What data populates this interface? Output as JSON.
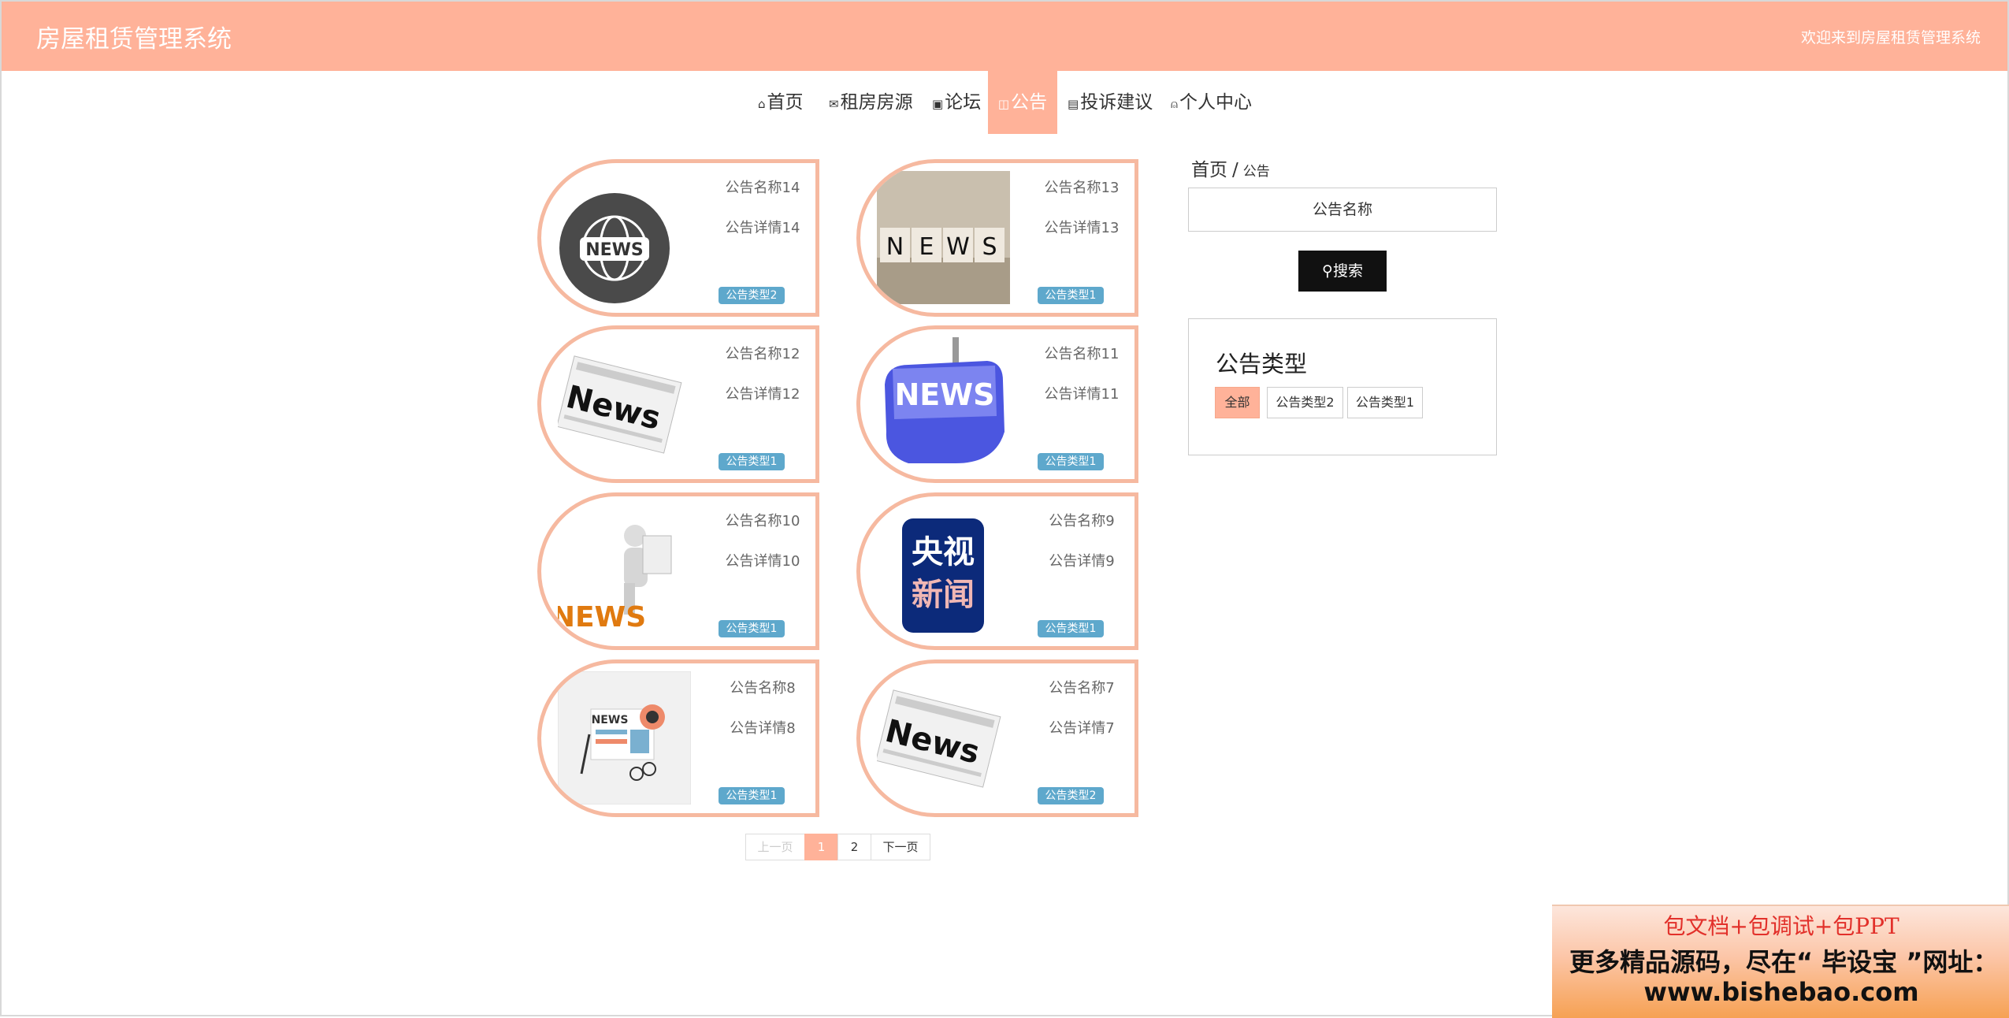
{
  "header": {
    "title": "房屋租赁管理系统",
    "welcome": "欢迎来到房屋租赁管理系统"
  },
  "nav": {
    "items": [
      {
        "icon": "home-icon",
        "glyph": "⌂",
        "label": "首页"
      },
      {
        "icon": "mail-icon",
        "glyph": "✉",
        "label": "租房房源"
      },
      {
        "icon": "gift-icon",
        "glyph": "▣",
        "label": "论坛"
      },
      {
        "icon": "notice-icon",
        "glyph": "◫",
        "label": "公告"
      },
      {
        "icon": "feedback-icon",
        "glyph": "▤",
        "label": "投诉建议"
      },
      {
        "icon": "user-icon",
        "glyph": "⍝",
        "label": "个人中心"
      }
    ],
    "active": "公告"
  },
  "cards": [
    {
      "name": "公告名称14",
      "detail": "公告详情14",
      "type": "公告类型2",
      "image": "news-globe-image"
    },
    {
      "name": "公告名称13",
      "detail": "公告详情13",
      "type": "公告类型1",
      "image": "news-dice-image"
    },
    {
      "name": "公告名称12",
      "detail": "公告详情12",
      "type": "公告类型1",
      "image": "newspaper-image"
    },
    {
      "name": "公告名称11",
      "detail": "公告详情11",
      "type": "公告类型1",
      "image": "news-key-image"
    },
    {
      "name": "公告名称10",
      "detail": "公告详情10",
      "type": "公告类型1",
      "image": "news-figure-image"
    },
    {
      "name": "公告名称9",
      "detail": "公告详情9",
      "type": "公告类型1",
      "image": "cctv-news-logo",
      "logo_text": [
        "央视",
        "新闻"
      ]
    },
    {
      "name": "公告名称8",
      "detail": "公告详情8",
      "type": "公告类型1",
      "image": "news-desk-image"
    },
    {
      "name": "公告名称7",
      "detail": "公告详情7",
      "type": "公告类型2",
      "image": "newspaper-image"
    }
  ],
  "pagination": {
    "prev": "上一页",
    "pages": [
      "1",
      "2"
    ],
    "current": "1",
    "next": "下一页"
  },
  "sidebar": {
    "breadcrumb_home": "首页",
    "breadcrumb_sep": "/",
    "breadcrumb_current": "公告",
    "search_value": "公告名称",
    "search_button": "搜索",
    "type_title": "公告类型",
    "tags": [
      "全部",
      "公告类型2",
      "公告类型1"
    ],
    "active_tag": "全部"
  },
  "ad": {
    "line1": "包文档+包调试+包PPT",
    "line2": "更多精品源码，尽在“ 毕设宝 ”网址：",
    "line3": "www.bishebao.com"
  },
  "colors": {
    "accent": "#ffb299",
    "card_border": "#f6b9a0",
    "tag": "#5ea8cc"
  }
}
